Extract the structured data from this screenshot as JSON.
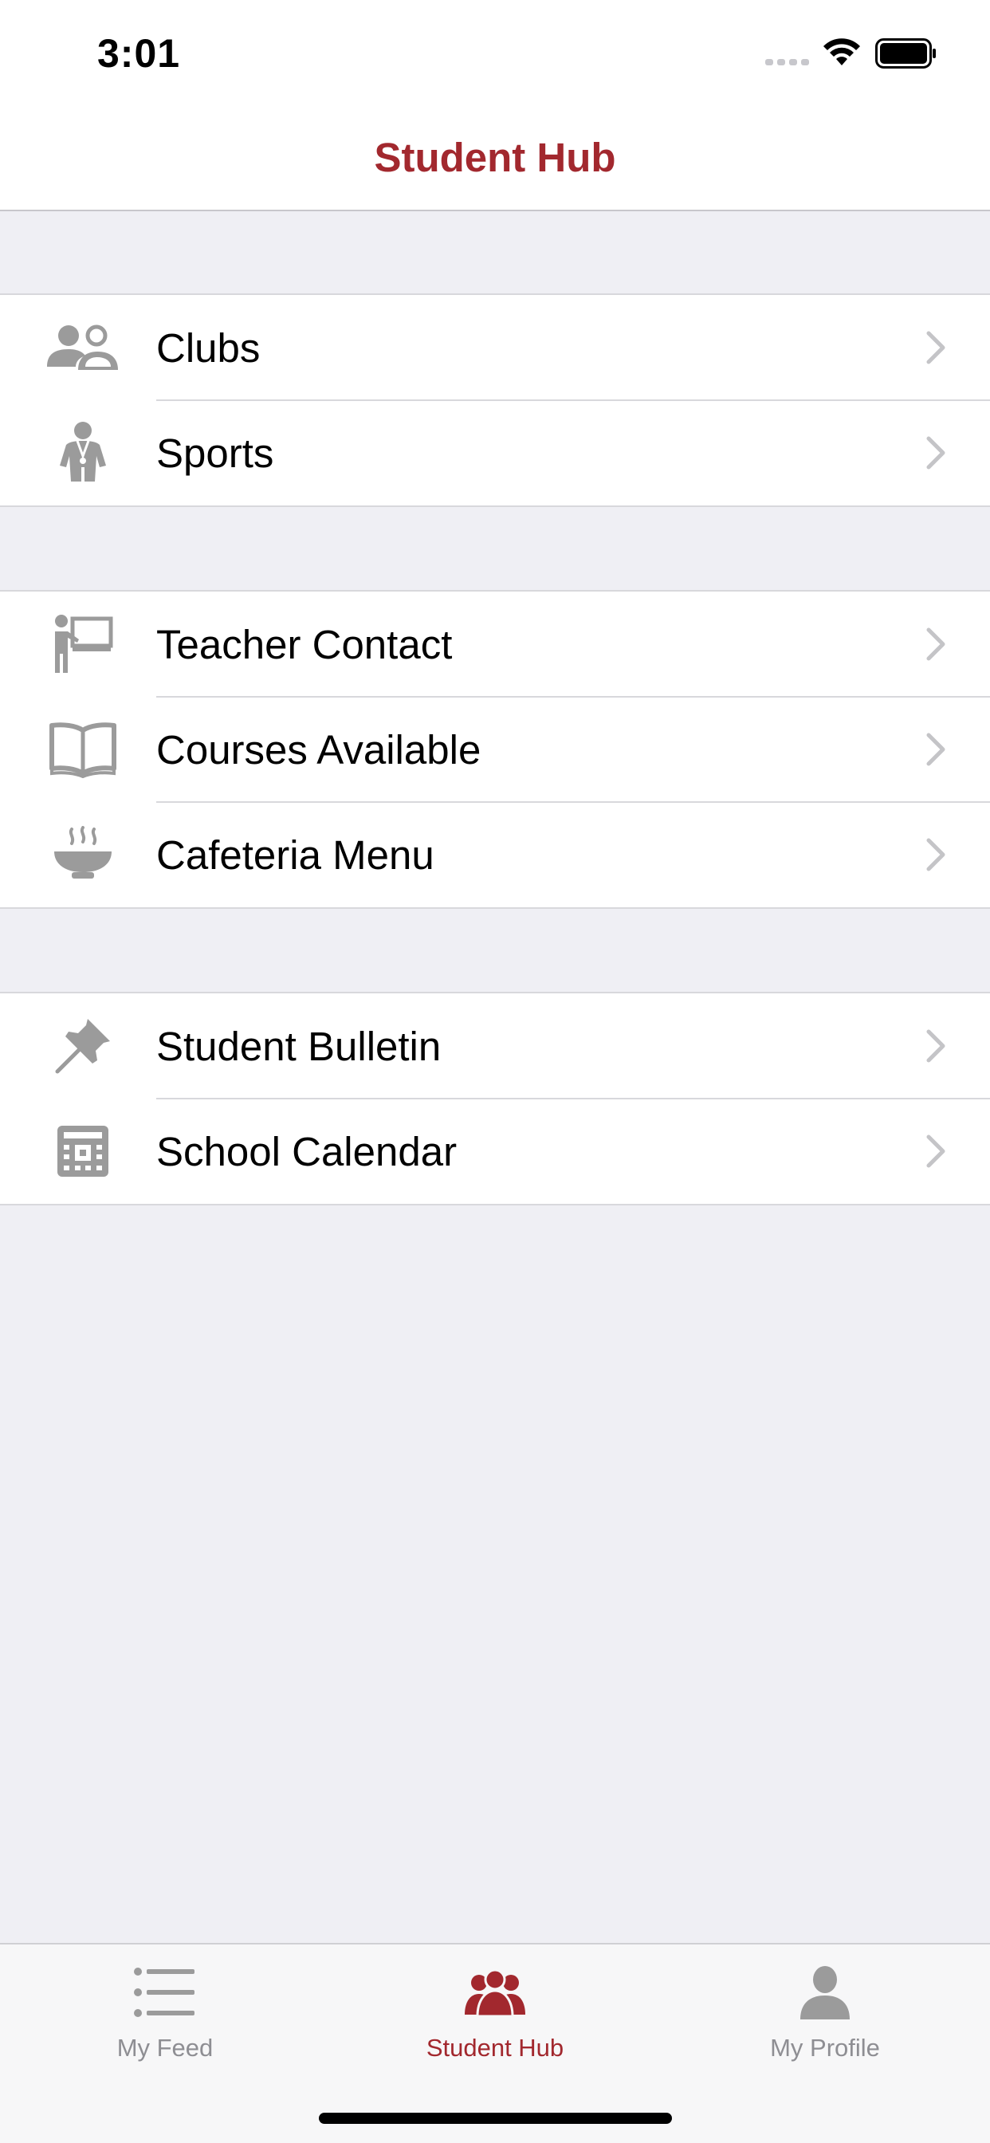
{
  "status_bar": {
    "time": "3:01"
  },
  "nav": {
    "title": "Student Hub"
  },
  "colors": {
    "accent": "#A2282E",
    "icon_gray": "#9B9B9B",
    "background": "#EFEFF4",
    "inactive_tab": "#8E8E93"
  },
  "sections": [
    {
      "items": [
        {
          "label": "Clubs",
          "icon": "group-icon"
        },
        {
          "label": "Sports",
          "icon": "athlete-icon"
        }
      ]
    },
    {
      "items": [
        {
          "label": "Teacher Contact",
          "icon": "teacher-board-icon"
        },
        {
          "label": "Courses Available",
          "icon": "open-book-icon"
        },
        {
          "label": "Cafeteria Menu",
          "icon": "soup-bowl-icon"
        }
      ]
    },
    {
      "items": [
        {
          "label": "Student Bulletin",
          "icon": "pushpin-icon"
        },
        {
          "label": "School Calendar",
          "icon": "calendar-icon"
        }
      ]
    }
  ],
  "tab_bar": {
    "tabs": [
      {
        "label": "My Feed",
        "icon": "list-icon",
        "active": false
      },
      {
        "label": "Student Hub",
        "icon": "people-icon",
        "active": true
      },
      {
        "label": "My Profile",
        "icon": "person-icon",
        "active": false
      }
    ]
  }
}
